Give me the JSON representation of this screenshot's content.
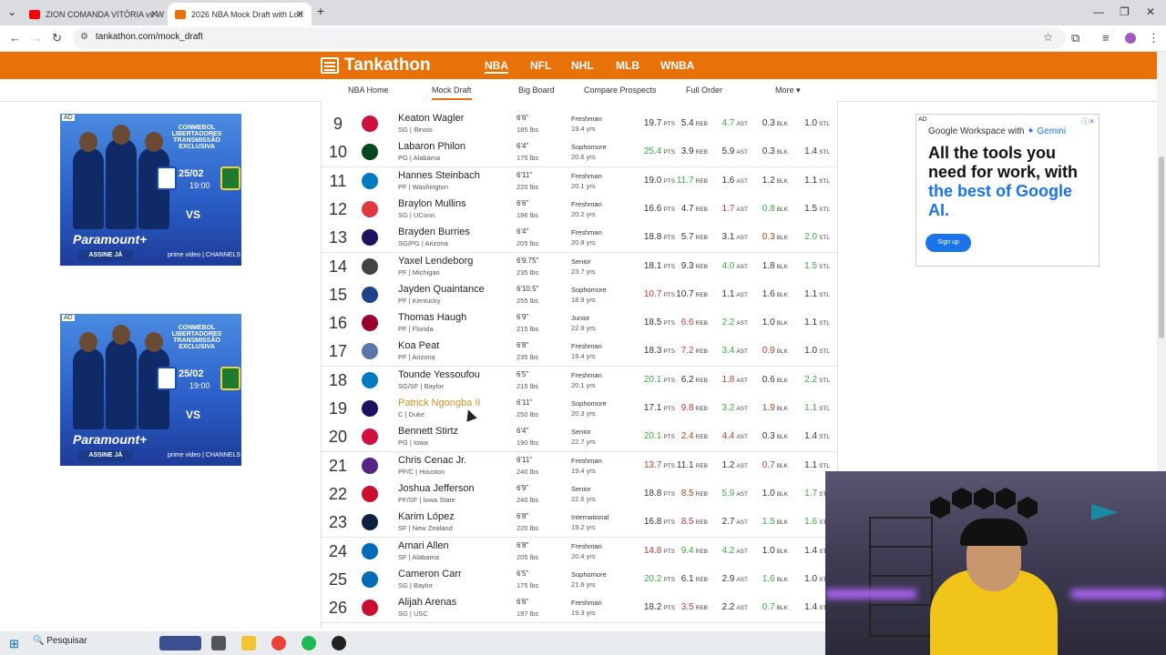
{
  "browser": {
    "tabs": [
      {
        "label": "ZION COMANDA VITÓRIA vs W",
        "active": false,
        "favicon_color": "#ff0000"
      },
      {
        "label": "2026 NBA Mock Draft with Lott",
        "active": true,
        "favicon_color": "#e8710a"
      }
    ],
    "new_tab": "+",
    "url": "tankathon.com/mock_draft"
  },
  "site": {
    "logo": "Tankathon",
    "sports": [
      "NBA",
      "NFL",
      "NHL",
      "MLB",
      "WNBA"
    ],
    "active_sport": "NBA",
    "subnav": [
      "NBA Home",
      "Mock Draft",
      "Big Board",
      "Compare Prospects",
      "Full Order",
      "More ▾"
    ],
    "active_subnav": "Mock Draft",
    "accent": "#e8710a"
  },
  "left_ad": {
    "tag": "AD",
    "title": "CONMEBOL LIBERTADORES TRANSMISSÃO EXCLUSIVA",
    "date": "25/02",
    "time": "19:00",
    "vs": "VS",
    "brand": "Paramount+",
    "cta": "ASSINE JÁ",
    "partner": "prime video | CHANNELS"
  },
  "right_ad": {
    "tag": "AD",
    "brand_prefix": "Google Workspace with",
    "brand_suffix": "Gemini",
    "headline_1": "All the tools you need for work, with",
    "headline_2": "the best of Google AI.",
    "cta": "Sign up"
  },
  "stat_units": {
    "pts": "PTS",
    "reb": "REB",
    "ast": "AST",
    "blk": "BLK",
    "stl": "STL"
  },
  "picks": [
    {
      "pick": "9",
      "name": "Keaton Wagler",
      "pos_school": "SG | Illinois",
      "height": "6'6\"",
      "weight": "185 lbs",
      "class": "Freshman",
      "age": "19.4 yrs",
      "pts": "19.7",
      "reb": "5.4",
      "ast": "4.7",
      "blk": "0.3",
      "stl": "1.0",
      "c": [
        "n",
        "n",
        "g",
        "n",
        "n"
      ],
      "team_color": "#ce1141"
    },
    {
      "pick": "10",
      "name": "Labaron Philon",
      "pos_school": "PG | Alabama",
      "height": "6'4\"",
      "weight": "175 lbs",
      "class": "Sophomore",
      "age": "20.6 yrs",
      "pts": "25.4",
      "reb": "3.9",
      "ast": "5.9",
      "blk": "0.3",
      "stl": "1.4",
      "c": [
        "g",
        "n",
        "n",
        "n",
        "n"
      ],
      "team_color": "#00471b"
    },
    {
      "pick": "11",
      "name": "Hannes Steinbach",
      "pos_school": "PF | Washington",
      "height": "6'11\"",
      "weight": "220 lbs",
      "class": "Freshman",
      "age": "20.1 yrs",
      "pts": "19.0",
      "reb": "11.7",
      "ast": "1.6",
      "blk": "1.2",
      "stl": "1.1",
      "c": [
        "n",
        "g",
        "n",
        "n",
        "n"
      ],
      "team_color": "#007ac1"
    },
    {
      "pick": "12",
      "name": "Braylon Mullins",
      "pos_school": "SG | UConn",
      "height": "6'6\"",
      "weight": "196 lbs",
      "class": "Freshman",
      "age": "20.2 yrs",
      "pts": "16.6",
      "reb": "4.7",
      "ast": "1.7",
      "blk": "0.8",
      "stl": "1.5",
      "c": [
        "n",
        "n",
        "r",
        "g",
        "n"
      ],
      "team_color": "#e03a3e"
    },
    {
      "pick": "13",
      "name": "Brayden Burries",
      "pos_school": "SG/PG | Arizona",
      "height": "6'4\"",
      "weight": "205 lbs",
      "class": "Freshman",
      "age": "20.8 yrs",
      "pts": "18.8",
      "reb": "5.7",
      "ast": "3.1",
      "blk": "0.3",
      "stl": "2.0",
      "c": [
        "n",
        "n",
        "n",
        "r",
        "g"
      ],
      "team_color": "#1d1160"
    },
    {
      "pick": "14",
      "name": "Yaxel Lendeborg",
      "pos_school": "PF | Michigan",
      "height": "6'9.75\"",
      "weight": "235 lbs",
      "class": "Senior",
      "age": "23.7 yrs",
      "pts": "18.1",
      "reb": "9.3",
      "ast": "4.0",
      "blk": "1.8",
      "stl": "1.5",
      "c": [
        "n",
        "n",
        "g",
        "n",
        "g"
      ],
      "team_color": "#444444"
    },
    {
      "pick": "15",
      "name": "Jayden Quaintance",
      "pos_school": "PF | Kentucky",
      "height": "6'10.5\"",
      "weight": "255 lbs",
      "class": "Sophomore",
      "age": "18.9 yrs",
      "pts": "10.7",
      "reb": "10.7",
      "ast": "1.1",
      "blk": "1.6",
      "stl": "1.1",
      "c": [
        "r",
        "n",
        "n",
        "n",
        "n"
      ],
      "team_color": "#1d428a"
    },
    {
      "pick": "16",
      "name": "Thomas Haugh",
      "pos_school": "PF | Florida",
      "height": "6'9\"",
      "weight": "215 lbs",
      "class": "Junior",
      "age": "22.9 yrs",
      "pts": "18.5",
      "reb": "6.6",
      "ast": "2.2",
      "blk": "1.0",
      "stl": "1.1",
      "c": [
        "n",
        "r",
        "g",
        "n",
        "n"
      ],
      "team_color": "#98002e"
    },
    {
      "pick": "17",
      "name": "Koa Peat",
      "pos_school": "PF | Arizona",
      "height": "6'8\"",
      "weight": "235 lbs",
      "class": "Freshman",
      "age": "19.4 yrs",
      "pts": "18.3",
      "reb": "7.2",
      "ast": "3.4",
      "blk": "0.9",
      "stl": "1.0",
      "c": [
        "n",
        "r",
        "g",
        "r",
        "n"
      ],
      "team_color": "#5d76a9"
    },
    {
      "pick": "18",
      "name": "Tounde Yessoufou",
      "pos_school": "SG/SF | Baylor",
      "height": "6'5\"",
      "weight": "215 lbs",
      "class": "Freshman",
      "age": "20.1 yrs",
      "pts": "20.1",
      "reb": "6.2",
      "ast": "1.8",
      "blk": "0.6",
      "stl": "2.2",
      "c": [
        "g",
        "n",
        "r",
        "n",
        "g"
      ],
      "team_color": "#007ac1"
    },
    {
      "pick": "19",
      "name": "Patrick Ngongba II",
      "pos_school": "C | Duke",
      "height": "6'11\"",
      "weight": "250 lbs",
      "class": "Sophomore",
      "age": "20.3 yrs",
      "pts": "17.1",
      "reb": "9.8",
      "ast": "3.2",
      "blk": "1.9",
      "stl": "1.1",
      "c": [
        "n",
        "r",
        "g",
        "r",
        "g"
      ],
      "team_color": "#1d1160",
      "highlight": true
    },
    {
      "pick": "20",
      "name": "Bennett Stirtz",
      "pos_school": "PG | Iowa",
      "height": "6'4\"",
      "weight": "190 lbs",
      "class": "Senior",
      "age": "22.7 yrs",
      "pts": "20.1",
      "reb": "2.4",
      "ast": "4.4",
      "blk": "0.3",
      "stl": "1.4",
      "c": [
        "g",
        "r",
        "r",
        "n",
        "n"
      ],
      "team_color": "#ce1141"
    },
    {
      "pick": "21",
      "name": "Chris Cenac Jr.",
      "pos_school": "PF/C | Houston",
      "height": "6'11\"",
      "weight": "240 lbs",
      "class": "Freshman",
      "age": "19.4 yrs",
      "pts": "13.7",
      "reb": "11.1",
      "ast": "1.2",
      "blk": "0.7",
      "stl": "1.1",
      "c": [
        "r",
        "n",
        "n",
        "r",
        "n"
      ],
      "team_color": "#552583"
    },
    {
      "pick": "22",
      "name": "Joshua Jefferson",
      "pos_school": "PF/SF | Iowa State",
      "height": "6'9\"",
      "weight": "240 lbs",
      "class": "Senior",
      "age": "22.6 yrs",
      "pts": "18.8",
      "reb": "8.5",
      "ast": "5.9",
      "blk": "1.0",
      "stl": "1.7",
      "c": [
        "n",
        "r",
        "g",
        "n",
        "g"
      ],
      "team_color": "#c8102e"
    },
    {
      "pick": "23",
      "name": "Karim López",
      "pos_school": "SF | New Zealand",
      "height": "6'8\"",
      "weight": "220 lbs",
      "class": "International",
      "age": "19.2 yrs",
      "pts": "16.8",
      "reb": "8.5",
      "ast": "2.7",
      "blk": "1.5",
      "stl": "1.6",
      "c": [
        "n",
        "r",
        "n",
        "g",
        "g"
      ],
      "team_color": "#0e2240"
    },
    {
      "pick": "24",
      "name": "Amari Allen",
      "pos_school": "SF | Alabama",
      "height": "6'8\"",
      "weight": "205 lbs",
      "class": "Freshman",
      "age": "20.4 yrs",
      "pts": "14.8",
      "reb": "9.4",
      "ast": "4.2",
      "blk": "1.0",
      "stl": "1.4",
      "c": [
        "r",
        "g",
        "g",
        "n",
        "n"
      ],
      "team_color": "#006bb6"
    },
    {
      "pick": "25",
      "name": "Cameron Carr",
      "pos_school": "SG | Baylor",
      "height": "6'5\"",
      "weight": "175 lbs",
      "class": "Sophomore",
      "age": "21.6 yrs",
      "pts": "20.2",
      "reb": "6.1",
      "ast": "2.9",
      "blk": "1.6",
      "stl": "1.0",
      "c": [
        "g",
        "n",
        "n",
        "g",
        "n"
      ],
      "team_color": "#006bb6"
    },
    {
      "pick": "26",
      "name": "Alijah Arenas",
      "pos_school": "SG | USC",
      "height": "6'6\"",
      "weight": "197 lbs",
      "class": "Freshman",
      "age": "19.3 yrs",
      "pts": "18.2",
      "reb": "3.5",
      "ast": "2.2",
      "blk": "0.7",
      "stl": "1.4",
      "c": [
        "n",
        "r",
        "n",
        "g",
        "n"
      ],
      "team_color": "#c8102e"
    }
  ],
  "taskbar": {
    "search": "Pesquisar"
  }
}
